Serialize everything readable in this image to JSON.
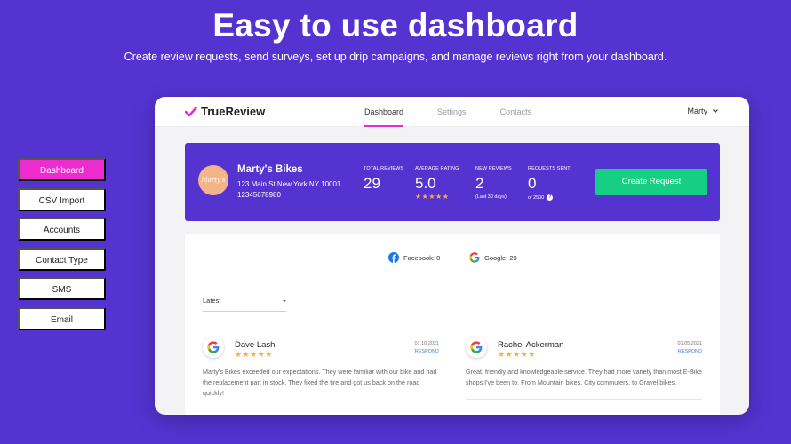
{
  "hero": {
    "title": "Easy to use dashboard",
    "subtitle": "Create review requests, send surveys, set up drip campaigns, and manage reviews right from your dashboard."
  },
  "side_nav": [
    {
      "label": "Dashboard",
      "active": true
    },
    {
      "label": "CSV Import",
      "active": false
    },
    {
      "label": "Accounts",
      "active": false
    },
    {
      "label": "Contact Type",
      "active": false
    },
    {
      "label": "SMS",
      "active": false
    },
    {
      "label": "Email",
      "active": false
    }
  ],
  "app": {
    "logo": "TrueReview",
    "nav": [
      {
        "label": "Dashboard",
        "active": true
      },
      {
        "label": "Settings",
        "active": false
      },
      {
        "label": "Contacts",
        "active": false
      }
    ],
    "user": "Marty"
  },
  "business": {
    "avatar_text": "Marty's",
    "name": "Marty's Bikes",
    "address": "123 Main St New York NY 10001",
    "phone": "12345678980"
  },
  "stats": {
    "total_reviews": {
      "label": "TOTAL REVIEWS",
      "value": "29"
    },
    "average_rating": {
      "label": "AVERAGE RATING",
      "value": "5.0",
      "stars": "★★★★★"
    },
    "new_reviews": {
      "label": "NEW REVIEWS",
      "value": "2",
      "sub": "(Last 30 days)"
    },
    "requests_sent": {
      "label": "REQUESTS SENT",
      "value": "0",
      "sub": "of 2500"
    }
  },
  "create_request_label": "Create Request",
  "sources": {
    "facebook": "Facebook: 0",
    "google": "Google: 29"
  },
  "filter": {
    "selected": "Latest"
  },
  "reviews": [
    {
      "name": "Dave Lash",
      "stars": "★★★★★",
      "date": "01.10.2021",
      "respond": "RESPOND",
      "text": "Marty's Bikes exceeded our expectations. They were familiar with our bike and had the replacement part in stock. They fixed the tire and got us back on the road quickly!"
    },
    {
      "name": "Rachel Ackerman",
      "stars": "★★★★★",
      "date": "01.05.2021",
      "respond": "RESPOND",
      "text": "Great, friendly and knowledgeable service. They had more variety than most E-Bike shops I've been to. From Mountain bikes, City commuters, to Gravel bikes."
    }
  ],
  "colors": {
    "brand_purple": "#5533d1",
    "accent_pink": "#ec2ccf",
    "create_green": "#17cf82",
    "star_gold": "#f4b042",
    "link_blue": "#3d7be0"
  }
}
